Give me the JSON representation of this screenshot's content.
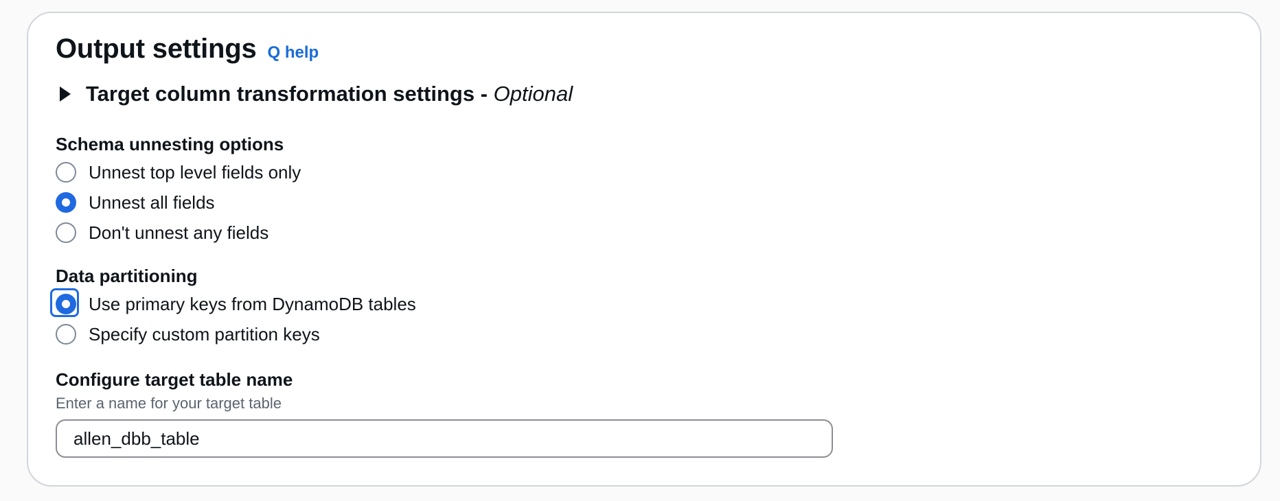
{
  "section": {
    "title": "Output settings",
    "help_link": "Q help"
  },
  "expander": {
    "label": "Target column transformation settings - ",
    "optional": "Optional",
    "expanded": false
  },
  "schema_unnesting": {
    "label": "Schema unnesting options",
    "options": [
      {
        "label": "Unnest top level fields only",
        "selected": false
      },
      {
        "label": "Unnest all fields",
        "selected": true
      },
      {
        "label": "Don't unnest any fields",
        "selected": false
      }
    ]
  },
  "data_partitioning": {
    "label": "Data partitioning",
    "options": [
      {
        "label": "Use primary keys from DynamoDB tables",
        "selected": true,
        "focused": true
      },
      {
        "label": "Specify custom partition keys",
        "selected": false
      }
    ]
  },
  "target_table": {
    "label": "Configure target table name",
    "description": "Enter a name for your target table",
    "value": "allen_dbb_table"
  },
  "colors": {
    "accent": "#1f6ae0",
    "link": "#1a6bd8",
    "border": "#d1d5db",
    "text": "#0f141a",
    "muted": "#5b6470"
  }
}
